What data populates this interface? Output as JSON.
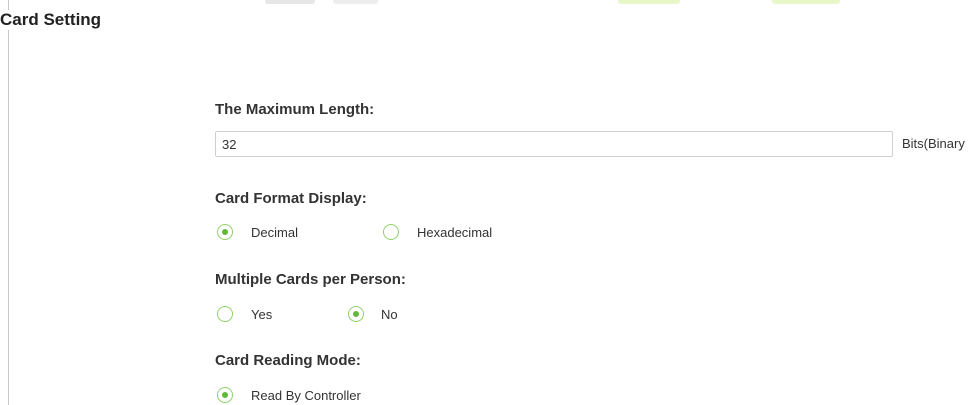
{
  "page_title": "Card Setting",
  "max_length": {
    "label": "The Maximum Length:",
    "value": "32",
    "unit": "Bits(Binary"
  },
  "card_format": {
    "label": "Card Format Display:",
    "options": [
      {
        "label": "Decimal",
        "selected": true
      },
      {
        "label": "Hexadecimal",
        "selected": false
      }
    ]
  },
  "multiple_cards": {
    "label": "Multiple Cards per Person:",
    "options": [
      {
        "label": "Yes",
        "selected": false
      },
      {
        "label": "No",
        "selected": true
      }
    ]
  },
  "reading_mode": {
    "label": "Card Reading Mode:",
    "options": [
      {
        "label": "Read By Controller",
        "selected": true
      }
    ]
  },
  "colors": {
    "radio_border": "#8fd16a",
    "radio_dot": "#5fb83a"
  }
}
